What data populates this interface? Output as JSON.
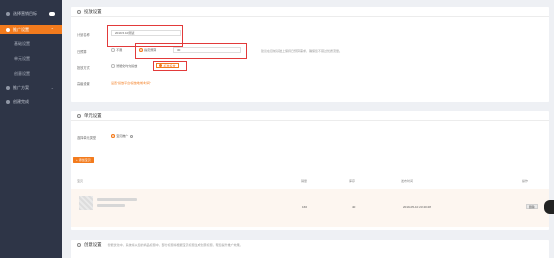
{
  "sidebar": {
    "items": [
      {
        "label": "选择营销目标"
      },
      {
        "label": "推广设置"
      },
      {
        "label": "基础设置"
      },
      {
        "label": "单元设置"
      },
      {
        "label": "创意设置"
      },
      {
        "label": "推广方案"
      },
      {
        "label": "创建完成"
      }
    ]
  },
  "basic": {
    "title": "投放设置",
    "plan_name_label": "计划名称",
    "plan_name_value": "2019.5.10测试",
    "budget_label": "日预算",
    "budget_unlimited": "不限",
    "budget_specified": "指定预算",
    "budget_value": "30",
    "budget_hint": "建议在目前基础上保持日预算需求，确保您不错过优质流量。",
    "delivery_label": "投放方式",
    "delivery_option1": "智能化均匀投放",
    "delivery_option2": "标准投放",
    "advanced_label": "高级设置",
    "advanced_link": "设置\"投放平台/投放地域/时间\""
  },
  "unit": {
    "title": "单元设置",
    "unit_type_label": "选择单元类型",
    "unit_type_value": "宝贝推广",
    "add_button": "添加宝贝",
    "columns": [
      "宝贝",
      "销量",
      "库存",
      "发布时间",
      "操作"
    ],
    "rows": [
      {
        "sales": "166",
        "stock": "40",
        "publish_time": "2019-05-10 23:40:28",
        "action": "删除"
      }
    ]
  },
  "creative": {
    "title": "创意设置",
    "hint": "智能优化中，系统将从您的商品标题中，部分标题将根据宝贝标题生成创意标题，帮您提升推广效果。"
  }
}
